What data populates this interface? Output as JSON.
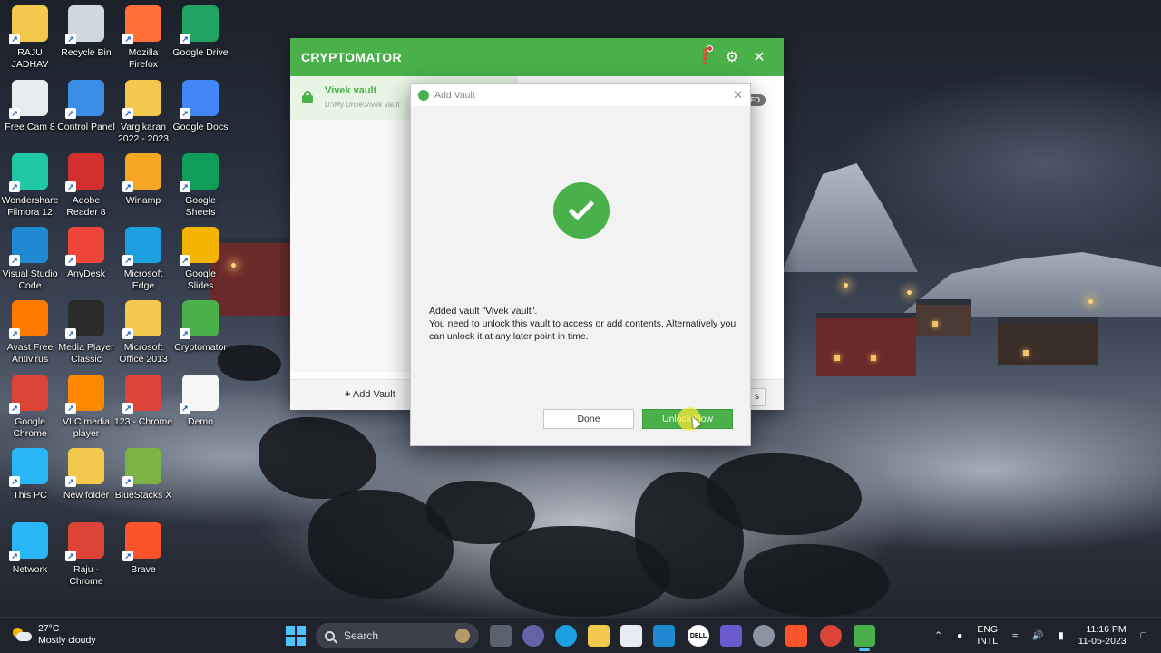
{
  "desktop_icons": [
    {
      "label": "RAJU\nJADHAV",
      "icon": "user-folder-icon",
      "color": "#f2c94c"
    },
    {
      "label": "Recycle Bin",
      "icon": "recycle-bin-icon",
      "color": "#cfd8dc"
    },
    {
      "label": "Mozilla\nFirefox",
      "icon": "firefox-icon",
      "color": "#ff7139"
    },
    {
      "label": "Google Drive",
      "icon": "google-drive-icon",
      "color": "#1fa463"
    },
    {
      "label": "Free Cam 8",
      "icon": "free-cam-icon",
      "color": "#e9ecef"
    },
    {
      "label": "Control Panel",
      "icon": "control-panel-icon",
      "color": "#3a8ee6"
    },
    {
      "label": "Vargikaran\n2022 - 2023",
      "icon": "folder-icon",
      "color": "#f2c94c"
    },
    {
      "label": "Google Docs",
      "icon": "google-docs-icon",
      "color": "#4285f4"
    },
    {
      "label": "Wondershare\nFilmora 12",
      "icon": "filmora-icon",
      "color": "#1ec8a5"
    },
    {
      "label": "Adobe\nReader 8",
      "icon": "adobe-reader-icon",
      "color": "#d32f2f"
    },
    {
      "label": "Winamp",
      "icon": "winamp-icon",
      "color": "#f5a623"
    },
    {
      "label": "Google\nSheets",
      "icon": "google-sheets-icon",
      "color": "#0f9d58"
    },
    {
      "label": "Visual Studio\nCode",
      "icon": "vscode-icon",
      "color": "#1f8ad2"
    },
    {
      "label": "AnyDesk",
      "icon": "anydesk-icon",
      "color": "#ef443b"
    },
    {
      "label": "Microsoft\nEdge",
      "icon": "edge-icon",
      "color": "#1da0e0"
    },
    {
      "label": "Google\nSlides",
      "icon": "google-slides-icon",
      "color": "#f4b400"
    },
    {
      "label": "Avast Free\nAntivirus",
      "icon": "avast-icon",
      "color": "#ff7800"
    },
    {
      "label": "Media Player\nClassic",
      "icon": "media-player-classic-icon",
      "color": "#2b2b2b"
    },
    {
      "label": "Microsoft\nOffice 2013",
      "icon": "folder-icon",
      "color": "#f2c94c"
    },
    {
      "label": "Cryptomator",
      "icon": "cryptomator-icon",
      "color": "#49b04a"
    },
    {
      "label": "Google\nChrome",
      "icon": "chrome-icon",
      "color": "#db4437"
    },
    {
      "label": "VLC media\nplayer",
      "icon": "vlc-icon",
      "color": "#ff8800"
    },
    {
      "label": "123 - Chrome",
      "icon": "chrome-icon",
      "color": "#db4437"
    },
    {
      "label": "Demo",
      "icon": "document-icon",
      "color": "#f5f5f5"
    },
    {
      "label": "This PC",
      "icon": "this-pc-icon",
      "color": "#29b6f6"
    },
    {
      "label": "New folder",
      "icon": "folder-icon",
      "color": "#f2c94c"
    },
    {
      "label": "BlueStacks X",
      "icon": "bluestacks-icon",
      "color": "#7cb342"
    },
    {
      "label": "",
      "icon": "",
      "color": ""
    },
    {
      "label": "Network",
      "icon": "network-icon",
      "color": "#29b6f6"
    },
    {
      "label": "Raju -\nChrome",
      "icon": "chrome-icon",
      "color": "#db4437"
    },
    {
      "label": "Brave",
      "icon": "brave-icon",
      "color": "#fb542b"
    }
  ],
  "cryptomator": {
    "title": "CRYPTOMATOR",
    "vault_name": "Vivek vault",
    "vault_path": "D:\\My Drive\\Vivek vault",
    "locked_badge": "ED",
    "add_vault_label": "Add Vault",
    "footer_btn_partial": "s",
    "accent": "#49b04a"
  },
  "dialog": {
    "title": "Add Vault",
    "message_line1": "Added vault \"Vivek vault\".",
    "message_line2": "You need to unlock this vault to access or add contents. Alternatively you can unlock it at any later point in time.",
    "done_label": "Done",
    "unlock_label": "Unlock Now"
  },
  "taskbar": {
    "weather_temp": "27°C",
    "weather_desc": "Mostly cloudy",
    "search_label": "Search",
    "lang_line1": "ENG",
    "lang_line2": "INTL",
    "time": "11:16 PM",
    "date": "11-05-2023"
  }
}
